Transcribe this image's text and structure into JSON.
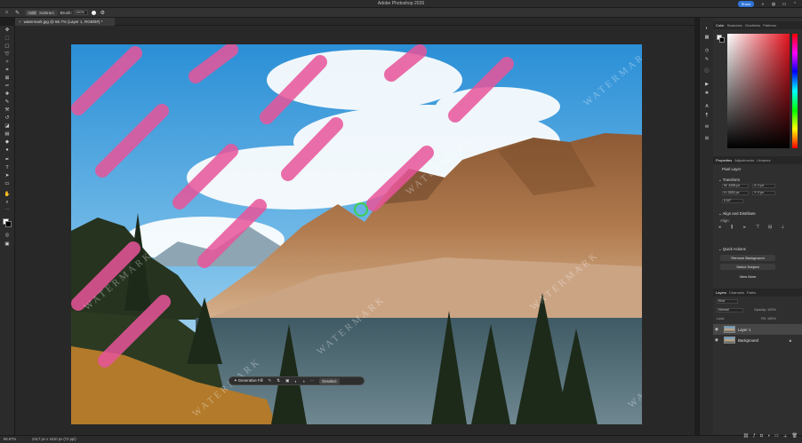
{
  "app": {
    "title": "Adobe Photoshop 2026"
  },
  "options_bar": {
    "home_icon": "home-icon",
    "tool_icon": "brush-icon",
    "mode_add": "Add",
    "mode_subtract": "Subtract",
    "brush_label": "Brush:",
    "brush_value": "100%",
    "share_label": "Share"
  },
  "tabs": [
    {
      "label": "watermark.jpg @ 66.7% (Layer 1, RGB/8#) *"
    }
  ],
  "toolbar": {
    "tools": [
      "move-icon",
      "artboard-icon",
      "marquee-icon",
      "lasso-icon",
      "object-select-icon",
      "crop-icon",
      "frame-icon",
      "eyedropper-icon",
      "spot-heal-icon",
      "brush-icon",
      "clone-stamp-icon",
      "history-brush-icon",
      "eraser-icon",
      "gradient-icon",
      "blur-icon",
      "dodge-icon",
      "pen-icon",
      "type-icon",
      "path-select-icon",
      "rectangle-icon",
      "hand-icon",
      "zoom-icon"
    ],
    "foreground_color": "#ffffff",
    "background_color": "#000000"
  },
  "canvas": {
    "watermark_text": "WATERMARK",
    "stroke_color": "#e8559a"
  },
  "context_bar": {
    "generative_fill": "Generative Fill",
    "deselect": "Deselect"
  },
  "status": {
    "zoom": "66.67%",
    "info": "2417 px x 1610 px (72 ppi)"
  },
  "panels": {
    "color_tabs": [
      "Color",
      "Swatches",
      "Gradients",
      "Patterns"
    ],
    "properties_tabs": [
      "Properties",
      "Adjustments",
      "Libraries"
    ],
    "pixel_layer": "Pixel Layer",
    "transform_label": "Transform",
    "w_value": "W: 4256 px",
    "h_value": "H: 2832 px",
    "x_value": "X: 0 px",
    "y_value": "Y: 0 px",
    "angle_value": "0.00°",
    "align_label": "Align and Distribute",
    "align_sub": "Align:",
    "quick_actions_label": "Quick Actions",
    "remove_background": "Remove Background",
    "select_subject": "Select Subject",
    "view_more": "View More",
    "layers_tabs": [
      "Layers",
      "Channels",
      "Paths"
    ],
    "kind_label": "Kind",
    "blend_mode": "Normal",
    "opacity": "Opacity: 100%",
    "lock_label": "Lock:",
    "fill": "Fill: 100%",
    "layers": [
      {
        "name": "Layer 1",
        "selected": true
      },
      {
        "name": "Background",
        "selected": false,
        "locked": true
      }
    ]
  }
}
